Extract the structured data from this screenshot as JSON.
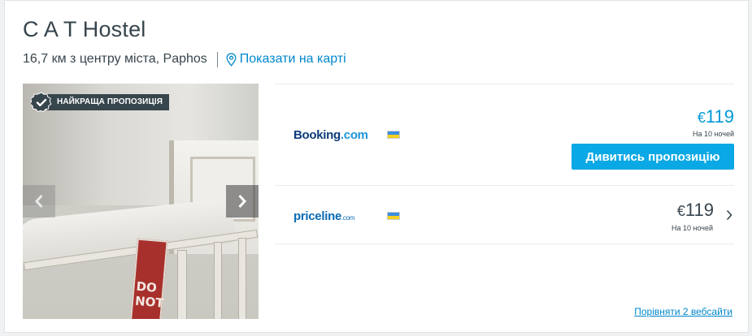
{
  "hotel": {
    "name": "C A T Hostel",
    "distance": "16,7 км з центру міста, Paphos",
    "map_link": "Показати на карті"
  },
  "gallery": {
    "badge": "НАЙКРАЩА ПРОПОЗИЦІЯ",
    "sign_text": "DO NOT"
  },
  "offers": [
    {
      "provider_name": "Booking",
      "provider_suffix": ".com",
      "flag_icon": "ukraine-flag-icon",
      "currency": "€",
      "price": "119",
      "nights": "На 10 ночей",
      "button_label": "Дивитись пропозицію"
    },
    {
      "provider_name": "priceline",
      "provider_suffix": ".com",
      "flag_icon": "ukraine-flag-icon",
      "currency": "€",
      "price": "119",
      "nights": "На 10 ночей"
    }
  ],
  "compare_link": "Порівняти 2 вебсайти",
  "colors": {
    "accent": "#0aa8e4",
    "link": "#0088cc",
    "text": "#37454d"
  }
}
